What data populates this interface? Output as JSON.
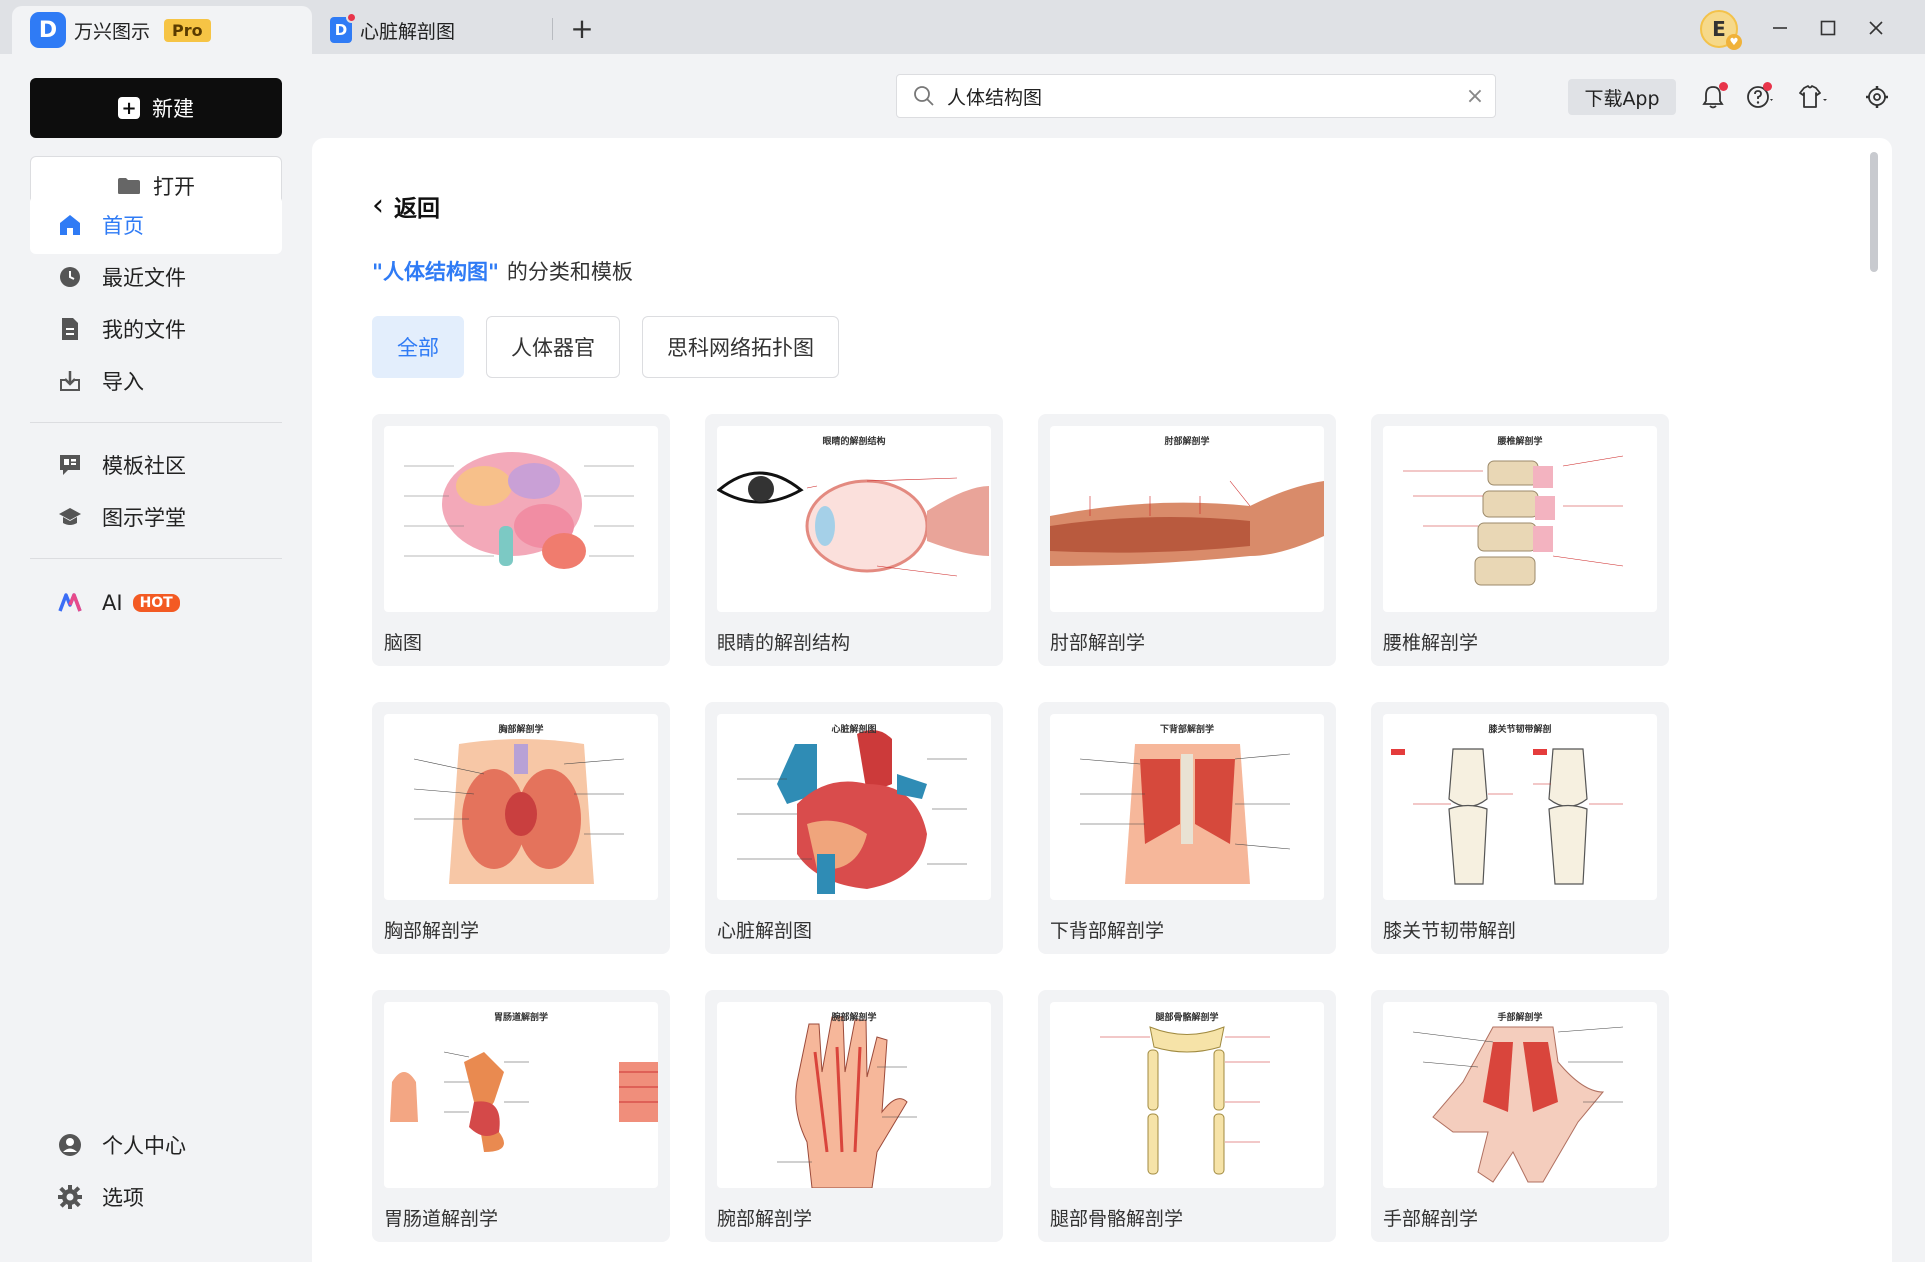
{
  "titlebar": {
    "app_name": "万兴图示",
    "pro_badge": "Pro",
    "doc_tab": "心脏解剖图",
    "avatar_letter": "E"
  },
  "sidebar": {
    "new_label": "新建",
    "open_label": "打开",
    "nav": {
      "home": "首页",
      "recent": "最近文件",
      "my_files": "我的文件",
      "import": "导入",
      "community": "模板社区",
      "academy": "图示学堂",
      "ai": "AI",
      "hot": "HOT",
      "profile": "个人中心",
      "options": "选项"
    }
  },
  "header": {
    "search_value": "人体结构图",
    "download_app": "下载App"
  },
  "main": {
    "back_label": "返回",
    "keyword": "\"人体结构图\"",
    "subtitle_suffix": "的分类和模板",
    "filters": [
      "全部",
      "人体器官",
      "思科网络拓扑图"
    ],
    "templates": [
      {
        "label": "脑图",
        "thumb_title": ""
      },
      {
        "label": "眼睛的解剖结构",
        "thumb_title": "眼睛的解剖结构"
      },
      {
        "label": "肘部解剖学",
        "thumb_title": "肘部解剖学"
      },
      {
        "label": "腰椎解剖学",
        "thumb_title": "腰椎解剖学"
      },
      {
        "label": "胸部解剖学",
        "thumb_title": "胸部解剖学"
      },
      {
        "label": "心脏解剖图",
        "thumb_title": "心脏解剖图"
      },
      {
        "label": "下背部解剖学",
        "thumb_title": "下背部解剖学"
      },
      {
        "label": "膝关节韧带解剖",
        "thumb_title": "膝关节韧带解剖"
      },
      {
        "label": "胃肠道解剖学",
        "thumb_title": "胃肠道解剖学"
      },
      {
        "label": "腕部解剖学",
        "thumb_title": "腕部解剖学"
      },
      {
        "label": "腿部骨骼解剖学",
        "thumb_title": "腿部骨骼解剖学"
      },
      {
        "label": "手部解剖学",
        "thumb_title": "手部解剖学"
      }
    ]
  },
  "colors": {
    "accent": "#2f7bf5",
    "sidebar_bg": "#f2f3f5",
    "hot": "#f35a23",
    "pro": "#f6c445"
  }
}
